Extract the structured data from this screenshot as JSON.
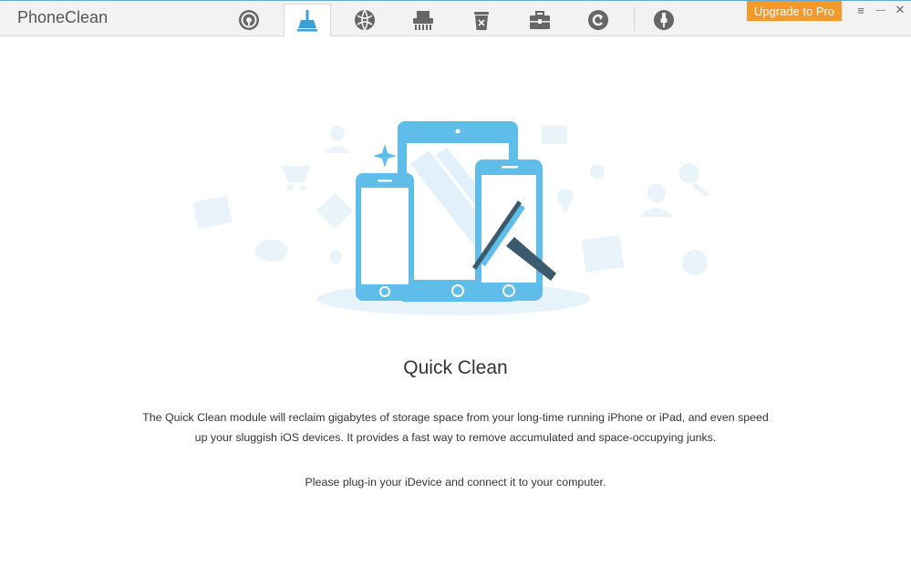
{
  "app": {
    "title": "PhoneClean"
  },
  "toolbar": {
    "tabs": [
      {
        "id": "tab-1",
        "icon": "gauge-icon"
      },
      {
        "id": "tab-2",
        "icon": "broom-icon",
        "active": true
      },
      {
        "id": "tab-3",
        "icon": "globe-icon"
      },
      {
        "id": "tab-4",
        "icon": "shredder-icon"
      },
      {
        "id": "tab-5",
        "icon": "trash-icon"
      },
      {
        "id": "tab-6",
        "icon": "toolbox-icon"
      },
      {
        "id": "tab-7",
        "icon": "refresh-icon"
      },
      {
        "id": "tab-8",
        "icon": "lightning-cable-icon"
      }
    ],
    "upgrade_label": "Upgrade to Pro",
    "menu_glyph": "≡",
    "minimize_glyph": "—",
    "close_glyph": "✕"
  },
  "colors": {
    "accent": "#5fbde9",
    "upgrade": "#f39a2b"
  },
  "main": {
    "heading": "Quick Clean",
    "description": "The Quick Clean module will reclaim gigabytes of storage space from your long-time running iPhone or iPad, and even speed up your sluggish iOS devices. It provides a fast way to remove accumulated and space-occupying junks.",
    "hint": "Please plug-in your iDevice and connect it to your computer."
  }
}
